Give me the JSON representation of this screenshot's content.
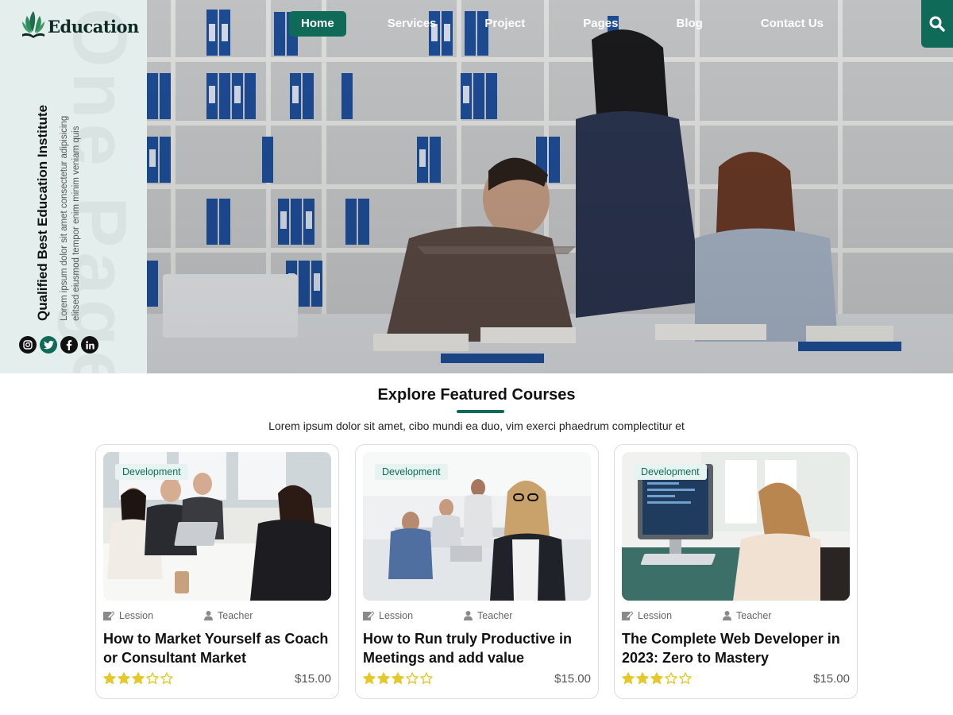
{
  "brand": {
    "name": "Education",
    "accent_color": "#0f6b57",
    "star_color": "#e5c82a"
  },
  "search": {
    "icon": "search-icon"
  },
  "nav": {
    "items": [
      {
        "label": "Home",
        "active": true
      },
      {
        "label": "Services",
        "active": false
      },
      {
        "label": "Project",
        "active": false
      },
      {
        "label": "Pages",
        "active": false
      },
      {
        "label": "Blog",
        "active": false
      },
      {
        "label": "Contact Us",
        "active": false
      }
    ]
  },
  "side_panel": {
    "title": "Qualified Best Education Institute",
    "description": "Lorem ipsum dolor sit amet consectetur adipisicing elitsed eiusmod tempor enim minim veniam quis",
    "watermark": "One Page",
    "socials": [
      {
        "name": "instagram-icon",
        "glyph": "◘"
      },
      {
        "name": "twitter-icon",
        "glyph": "✦"
      },
      {
        "name": "facebook-icon",
        "glyph": "f"
      },
      {
        "name": "linkedin-icon",
        "glyph": "in"
      }
    ]
  },
  "featured": {
    "title": "Explore Featured Courses",
    "subtitle": "Lorem ipsum dolor sit amet, cibo mundi ea duo, vim exerci phaedrum complectitur et",
    "courses": [
      {
        "category": "Development",
        "lession_label": "Lession",
        "teacher_label": "Teacher",
        "title": "How to Market Yourself as Coach or Consultant Market",
        "rating": 3,
        "max_rating": 5,
        "price": "$15.00",
        "image": "meeting-photo"
      },
      {
        "category": "Development",
        "lession_label": "Lession",
        "teacher_label": "Teacher",
        "title": "How to Run truly Productive in Meetings and add value",
        "rating": 3,
        "max_rating": 5,
        "price": "$15.00",
        "image": "office-photo"
      },
      {
        "category": "Development",
        "lession_label": "Lession",
        "teacher_label": "Teacher",
        "title": "The Complete Web Developer in 2023: Zero to Mastery",
        "rating": 3,
        "max_rating": 5,
        "price": "$15.00",
        "image": "developer-photo"
      }
    ]
  }
}
